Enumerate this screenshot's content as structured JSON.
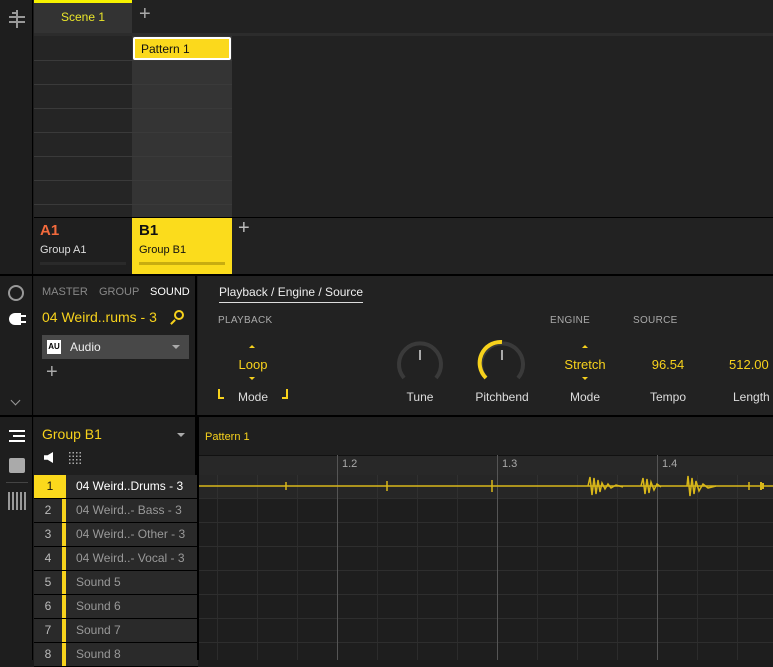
{
  "arranger": {
    "scene_tab": "Scene 1",
    "add_scene": "+",
    "pattern_clip": "Pattern 1",
    "groups": [
      {
        "letter": "A1",
        "name": "Group A1"
      },
      {
        "letter": "B1",
        "name": "Group B1"
      }
    ],
    "add_group": "+"
  },
  "sound_panel": {
    "tabs": [
      "MASTER",
      "GROUP",
      "SOUND"
    ],
    "active_tab": "SOUND",
    "sound_name": "04 Weird..rums - 3",
    "plugin": "Audio",
    "plugin_badge": "AU",
    "add_plugin": "+"
  },
  "params": {
    "page_tab": "Playback / Engine / Source",
    "sections": {
      "playback": "PLAYBACK",
      "engine": "ENGINE",
      "source": "SOURCE"
    },
    "playback_mode": {
      "value": "Loop",
      "label": "Mode"
    },
    "tune": {
      "label": "Tune",
      "value": 0
    },
    "pitchbend": {
      "label": "Pitchbend",
      "value": 0.5
    },
    "engine_mode": {
      "value": "Stretch",
      "label": "Mode"
    },
    "tempo": {
      "value": "96.54",
      "label": "Tempo"
    },
    "length": {
      "value": "512.00",
      "label": "Length"
    }
  },
  "pattern_editor": {
    "group": "Group B1",
    "pattern": "Pattern 1",
    "ruler": [
      "1.2",
      "1.3",
      "1.4"
    ],
    "sounds": [
      {
        "n": "1",
        "name": "04 Weird..Drums - 3"
      },
      {
        "n": "2",
        "name": "04 Weird..- Bass - 3"
      },
      {
        "n": "3",
        "name": "04 Weird..- Other - 3"
      },
      {
        "n": "4",
        "name": "04 Weird..- Vocal - 3"
      },
      {
        "n": "5",
        "name": "Sound 5"
      },
      {
        "n": "6",
        "name": "Sound 6"
      },
      {
        "n": "7",
        "name": "Sound 7"
      },
      {
        "n": "8",
        "name": "Sound 8"
      }
    ]
  },
  "colors": {
    "accent": "#f7d21c",
    "group_a": "#f26a3c",
    "background": "#1b1b1b"
  }
}
